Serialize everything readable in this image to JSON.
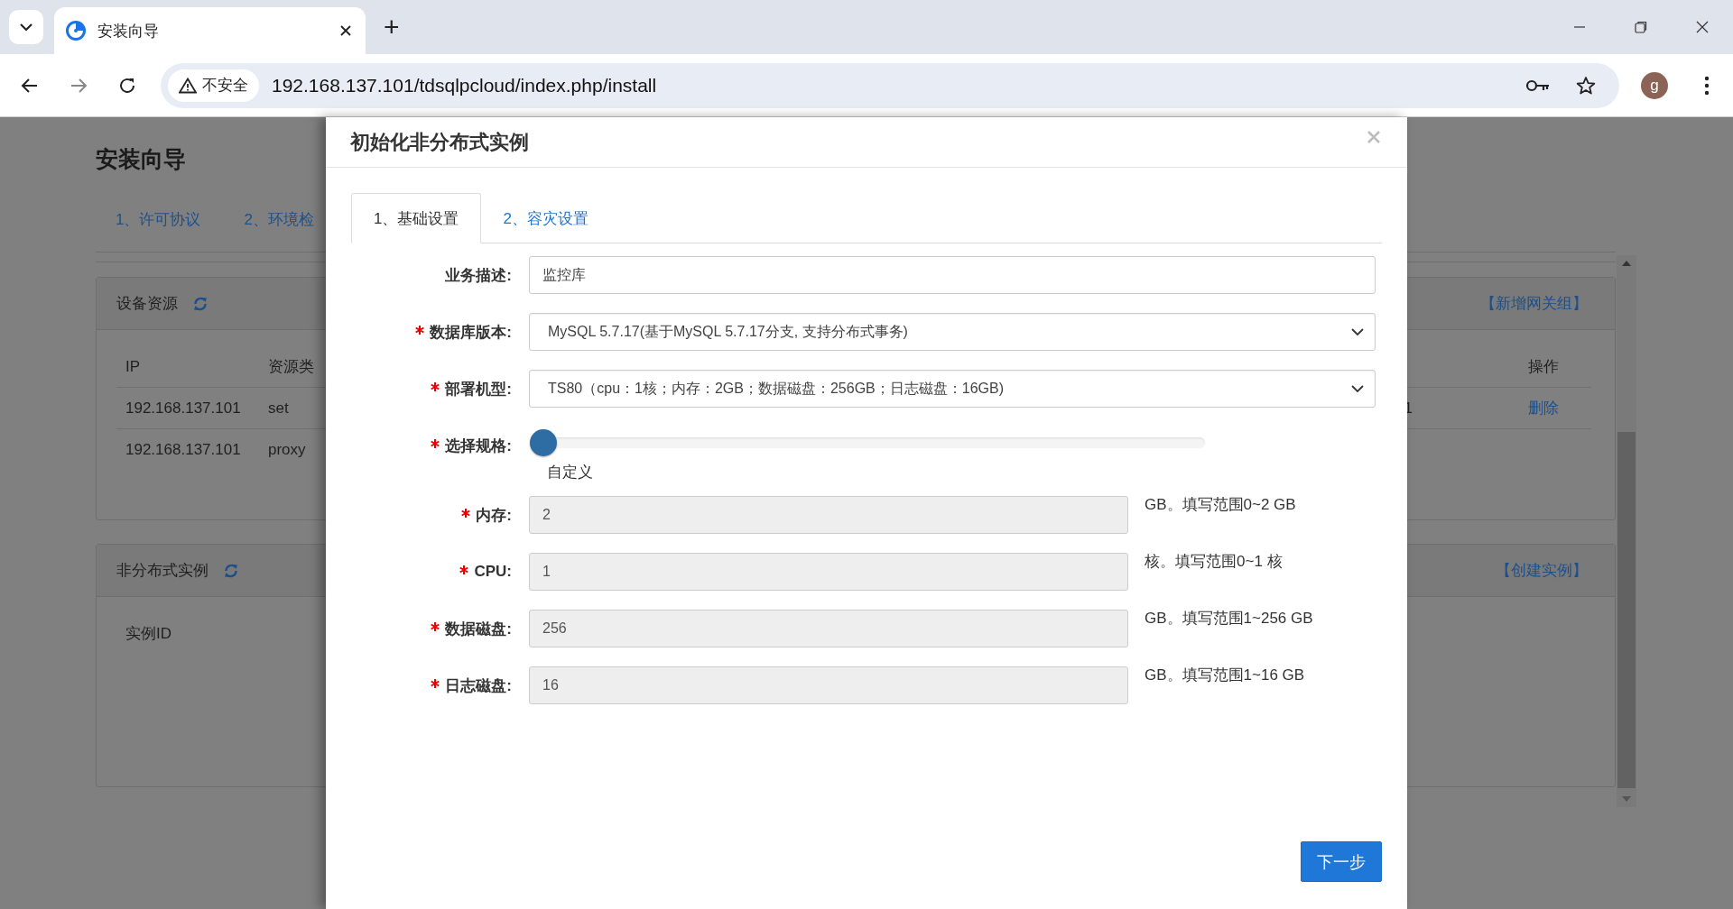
{
  "browser": {
    "tabs": [
      {
        "title": "安装向导",
        "selected": true
      }
    ],
    "new_tab": "+",
    "security": "不安全",
    "url": "192.168.137.101/tdsqlpcloud/index.php/install",
    "profile": "g"
  },
  "page": {
    "title": "安装向导",
    "steps": [
      "1、许可协议",
      "2、环境检"
    ],
    "panels": [
      {
        "title": "设备资源",
        "action": "【新增网关组】",
        "columns": [
          "IP",
          "资源类",
          "操作"
        ],
        "rows": [
          {
            "cells": [
              "192.168.137.101",
              "set"
            ],
            "column_3": "1",
            "action": "删除"
          },
          {
            "cells": [
              "192.168.137.101",
              "proxy"
            ]
          }
        ]
      },
      {
        "title": "非分布式实例",
        "action": "【创建实例】",
        "columns": [
          "实例ID"
        ]
      }
    ]
  },
  "modal": {
    "title": "初始化非分布式实例",
    "tabs": [
      {
        "label": "1、基础设置",
        "selected": true
      },
      {
        "label": "2、容灾设置",
        "selected": false
      }
    ],
    "fields": [
      {
        "kind": "text",
        "label": "业务描述:",
        "required": false,
        "value": "监控库"
      },
      {
        "kind": "select",
        "label": "数据库版本:",
        "required": true,
        "value": "MySQL 5.7.17(基于MySQL 5.7.17分支, 支持分布式事务)"
      },
      {
        "kind": "select",
        "label": "部署机型:",
        "required": true,
        "value": "TS80（cpu：1核；内存：2GB；数据磁盘：256GB；日志磁盘：16GB)"
      },
      {
        "kind": "slider",
        "label": "选择规格:",
        "required": true,
        "level": 0,
        "caption": "自定义"
      },
      {
        "kind": "number",
        "label": "内存:",
        "required": true,
        "value": "2",
        "disabled": true,
        "hint": "GB。填写范围0~2 GB"
      },
      {
        "kind": "number",
        "label": "CPU:",
        "required": true,
        "value": "1",
        "disabled": true,
        "hint": "核。填写范围0~1 核"
      },
      {
        "kind": "number",
        "label": "数据磁盘:",
        "required": true,
        "value": "256",
        "disabled": true,
        "hint": "GB。填写范围1~256 GB"
      },
      {
        "kind": "number",
        "label": "日志磁盘:",
        "required": true,
        "value": "16",
        "disabled": true,
        "hint": "GB。填写范围1~16 GB"
      }
    ],
    "next_button": "下一步"
  }
}
